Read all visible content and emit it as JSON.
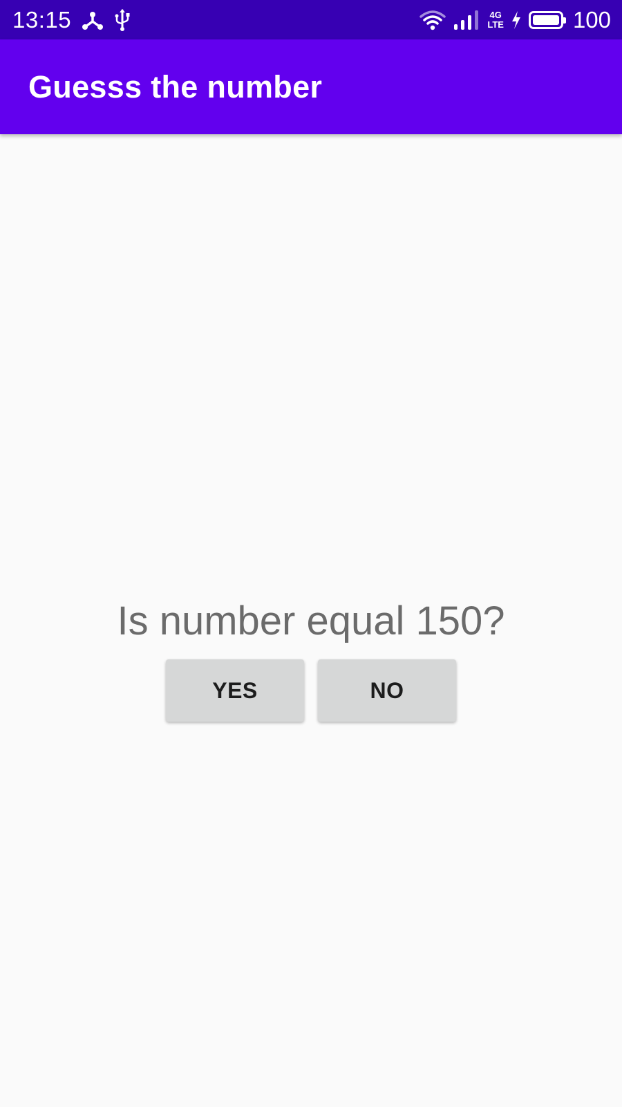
{
  "status_bar": {
    "time": "13:15",
    "network_type_top": "4G",
    "network_type_bottom": "LTE",
    "battery_level": "100",
    "battery_fraction": 1.0,
    "icons": [
      "share-icon",
      "usb-icon",
      "wifi-icon",
      "signal-icon",
      "charging-icon",
      "battery-icon"
    ]
  },
  "app_bar": {
    "title": "Guesss the number"
  },
  "main": {
    "question": "Is number equal 150?",
    "yes_label": "YES",
    "no_label": "NO"
  },
  "colors": {
    "status_bar": "#3700b3",
    "app_bar": "#6200ee",
    "background": "#fafafa",
    "button": "#d6d7d7",
    "question_text": "#6b6b6b"
  }
}
